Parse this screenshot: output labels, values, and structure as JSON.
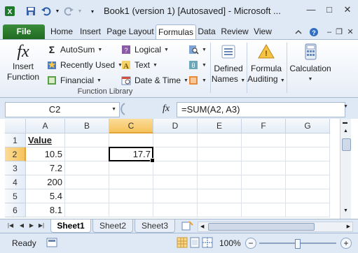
{
  "window": {
    "title": "Book1 (version 1) [Autosaved]  -  Microsoft ...",
    "icons": [
      "excel-app-icon",
      "save-icon",
      "undo-icon",
      "redo-icon",
      "customize-qat-icon",
      "minimize-icon",
      "maximize-icon",
      "close-icon"
    ]
  },
  "ribbon_tabs": [
    {
      "label": "File"
    },
    {
      "label": "Home"
    },
    {
      "label": "Insert"
    },
    {
      "label": "Page Layout"
    },
    {
      "label": "Formulas",
      "active": true
    },
    {
      "label": "Data"
    },
    {
      "label": "Review"
    },
    {
      "label": "View"
    }
  ],
  "ribbon": {
    "insert_function": {
      "line1": "Insert",
      "line2": "Function"
    },
    "function_library": {
      "autosum": "AutoSum",
      "recently_used": "Recently Used",
      "financial": "Financial",
      "logical": "Logical",
      "text": "Text",
      "date_time": "Date & Time",
      "group_label": "Function Library"
    },
    "defined_names": {
      "line1": "Defined",
      "line2": "Names"
    },
    "formula_auditing": {
      "line1": "Formula",
      "line2": "Auditing"
    },
    "calculation": {
      "label": "Calculation"
    }
  },
  "formula_bar": {
    "name_box": "C2",
    "fx_symbol": "fx",
    "formula": "=SUM(A2, A3)"
  },
  "grid": {
    "columns": [
      "A",
      "B",
      "C",
      "D",
      "E",
      "F",
      "G"
    ],
    "selected_column": "C",
    "rows": [
      {
        "num": "1",
        "cells": [
          "Value",
          "",
          "",
          "",
          "",
          "",
          ""
        ]
      },
      {
        "num": "2",
        "cells": [
          "10.5",
          "",
          "17.7",
          "",
          "",
          "",
          ""
        ]
      },
      {
        "num": "3",
        "cells": [
          "7.2",
          "",
          "",
          "",
          "",
          "",
          ""
        ]
      },
      {
        "num": "4",
        "cells": [
          "200",
          "",
          "",
          "",
          "",
          "",
          ""
        ]
      },
      {
        "num": "5",
        "cells": [
          "5.4",
          "",
          "",
          "",
          "",
          "",
          ""
        ]
      },
      {
        "num": "6",
        "cells": [
          "8.1",
          "",
          "",
          "",
          "",
          "",
          ""
        ]
      }
    ],
    "selected_row": "2",
    "active_cell": "C2"
  },
  "sheets": [
    {
      "label": "Sheet1",
      "active": true
    },
    {
      "label": "Sheet2"
    },
    {
      "label": "Sheet3"
    }
  ],
  "status": {
    "ready": "Ready",
    "zoom": "100%"
  },
  "colors": {
    "file_tab": "#2a7d2e",
    "ribbon_bg": "#dfe9f5",
    "selection_header": "#f6c35c"
  }
}
